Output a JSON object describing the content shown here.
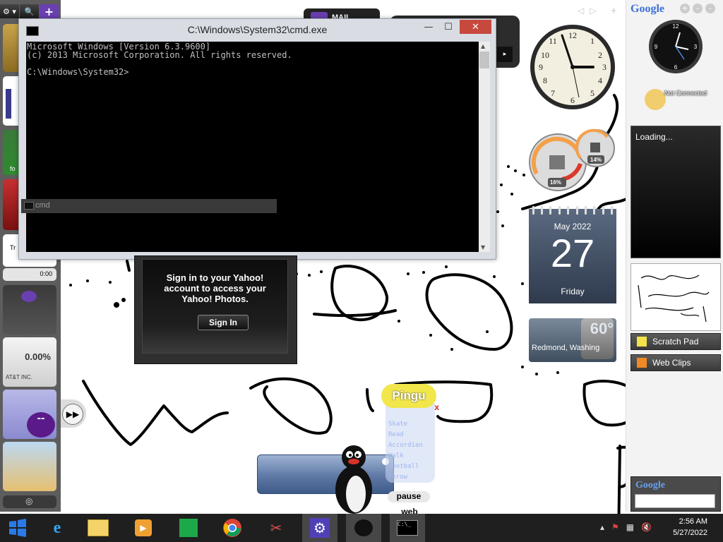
{
  "cmd": {
    "title": "C:\\Windows\\System32\\cmd.exe",
    "lines": [
      "Microsoft Windows [Version 6.3.9600]",
      "(c) 2013 Microsoft Corporation. All rights reserved.",
      "C:\\Windows\\System32>"
    ],
    "tooltip": "cmd",
    "minimize": "—",
    "maximize": "☐",
    "close": "✕"
  },
  "left_bar": {
    "buttons": [
      "⚙ ▾",
      "🔍",
      "+"
    ],
    "counter_time": "0:00",
    "stock_value": "0.00%",
    "stock_name": "AT&T INC."
  },
  "yahoo": {
    "message": "Sign in to your Yahoo!\naccount to access your\nYahoo! Photos.",
    "signin": "Sign In"
  },
  "mail": {
    "label": "MAIL"
  },
  "cpu_meter": {
    "cpu": "16%",
    "memory": "14%"
  },
  "calendar": {
    "month": "May 2022",
    "day": "27",
    "weekday": "Friday"
  },
  "weather": {
    "temp": "60°",
    "location": "Redmond, Washing"
  },
  "sidebar": {
    "google": "Google",
    "not_connected": "Not Connected",
    "loading": "Loading...",
    "items": [
      {
        "label": "Scratch Pad",
        "icon": "scratch-pad-icon"
      },
      {
        "label": "Web Clips",
        "icon": "rss-icon"
      }
    ],
    "search_logo": "Google"
  },
  "pingu": {
    "logo": "Pingu",
    "actions": [
      "Skate",
      "Read",
      "Accordian",
      "Walk",
      "Football",
      "Throw"
    ],
    "pause": "pause",
    "web": "web"
  },
  "taskbar": {
    "items": [
      "start-icon",
      "internet-explorer-icon",
      "file-explorer-icon",
      "media-player-icon",
      "store-icon",
      "chrome-icon",
      "snipping-tool-icon",
      "settings-icon",
      "pingu-icon",
      "cmd-icon"
    ],
    "time": "2:56 AM",
    "date": "5/27/2022"
  }
}
